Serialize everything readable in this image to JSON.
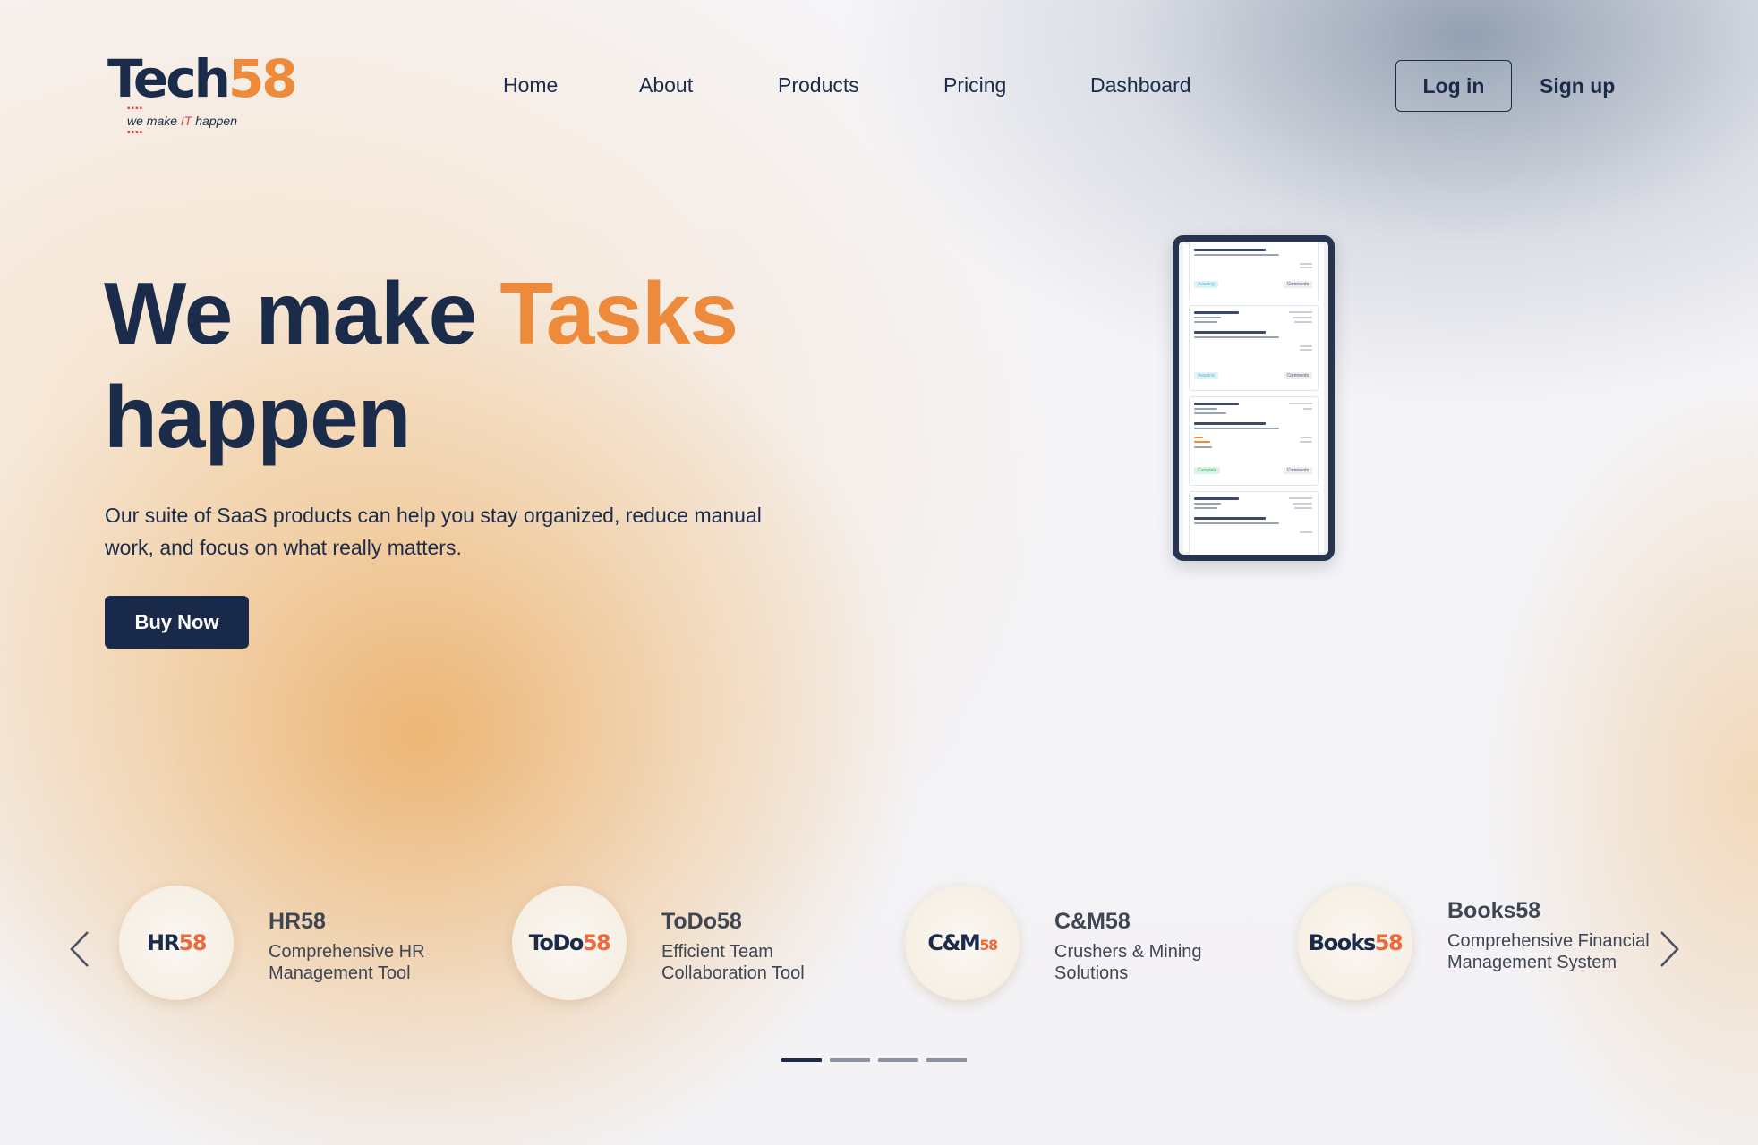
{
  "brand": {
    "name_part1": "Tech",
    "name_part2": "58",
    "tagline_pre": "we make ",
    "tagline_it": "IT",
    "tagline_post": " happen"
  },
  "nav": {
    "items": [
      "Home",
      "About",
      "Products",
      "Pricing",
      "Dashboard"
    ]
  },
  "auth": {
    "login_label": "Log in",
    "signup_label": "Sign up"
  },
  "hero": {
    "title_pre": "We make ",
    "title_accent": "Tasks",
    "title_post": "happen",
    "subtitle": "Our suite of SaaS products can help you stay organized, reduce manual work, and focus on what really matters.",
    "cta_label": "Buy Now"
  },
  "phone": {
    "tickets": [
      {
        "id": "# 145215254562",
        "date": "22 Jan 2020",
        "title": "Leave Reversal not working",
        "body": "Lorem ipsum dolor sit amet, sequn coma...",
        "status": "Awaiting",
        "comments": "Comments"
      },
      {
        "id": "# 145215254562",
        "date": "22 Jan 2020",
        "title": "Leave Reversal not working",
        "body": "Lorem ipsum dolor sit amet, sequn coma...",
        "status": "Awaiting",
        "comments": "Comments"
      },
      {
        "id": "# 145215254562",
        "date": "22 Jan 2020",
        "title": "Leave Reversal not working",
        "body": "Lorem ipsum dolor sit amet, sequn coma...",
        "status": "Complete",
        "comments": "Comments"
      },
      {
        "id": "# 145215254562",
        "date": "22 Jan 2020",
        "title": "Leave Reversal not working",
        "body": "Lorem ipsum dolor sit amet, sequn coma...",
        "status": "",
        "comments": ""
      }
    ]
  },
  "products": [
    {
      "logo_a": "HR",
      "logo_b": "58",
      "name": "HR58",
      "desc": "Comprehensive HR Management Tool"
    },
    {
      "logo_a": "ToDo",
      "logo_b": "58",
      "name": "ToDo58",
      "desc": "Efficient Team Collaboration Tool"
    },
    {
      "logo_a": "C&M",
      "logo_b": "58",
      "name": "C&M58",
      "desc": "Crushers & Mining Solutions"
    },
    {
      "logo_a": "Books",
      "logo_b": "58",
      "name": "Books58",
      "desc": "Comprehensive Financial Management System"
    }
  ],
  "carousel": {
    "active_index": 0,
    "page_count": 4
  },
  "colors": {
    "navy": "#1b2b4a",
    "accent_orange": "#ee8a3c",
    "button_bg": "#18294a"
  }
}
